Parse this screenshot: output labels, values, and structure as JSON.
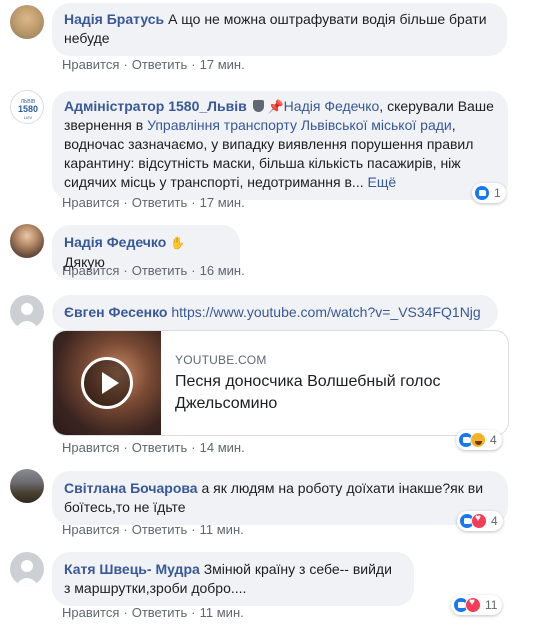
{
  "actions": {
    "like": "Нравится",
    "reply": "Ответить",
    "separator": "·"
  },
  "comments": [
    {
      "author": "Надія Братусь",
      "text": "А що не можна оштрафувати водія більше брати небуде",
      "time": "17 мин."
    },
    {
      "author": "Адміністратор 1580_Львів",
      "avatar_text": "Адміністратор 1580 Львів",
      "mention": "Надія Федечко",
      "text_1": ", скерували Ваше звернення в ",
      "link": "Управління транспорту Львівської міської ради",
      "text_2": ", водночас зазначаємо, у випадку виявлення порушення правил карантину: відсутність маски, більша кількість пасажирів, ніж сидячих місць у транспорті, недотримання в...",
      "more": "Ещё",
      "time": "17 мин.",
      "reaction_count": "1"
    },
    {
      "author": "Надія Федечко",
      "text": "Дякую",
      "time": "16 мин."
    },
    {
      "author": "Євген Фесенко",
      "url": "https://www.youtube.com/watch?v=_VS34FQ1Njg",
      "preview": {
        "domain": "YOUTUBE.COM",
        "title": "Песня доносчика Волшебный голос Джельсомино"
      },
      "time": "14 мин.",
      "reaction_count": "4"
    },
    {
      "author": "Світлана Бочарова",
      "text": "а як людям на роботу доїхати інакше?як ви боїтесь,то не їдьте",
      "time": "11 мин.",
      "reaction_count": "4"
    },
    {
      "author": "Катя Швець- Мудра",
      "text": "Змінюй країну з себе-- вийди з маршрутки,зроби добро....",
      "time": "11 мин.",
      "reaction_count": "11"
    }
  ],
  "colors": {
    "link": "#385898",
    "bubble": "#f0f2f5",
    "meta": "#606770"
  }
}
